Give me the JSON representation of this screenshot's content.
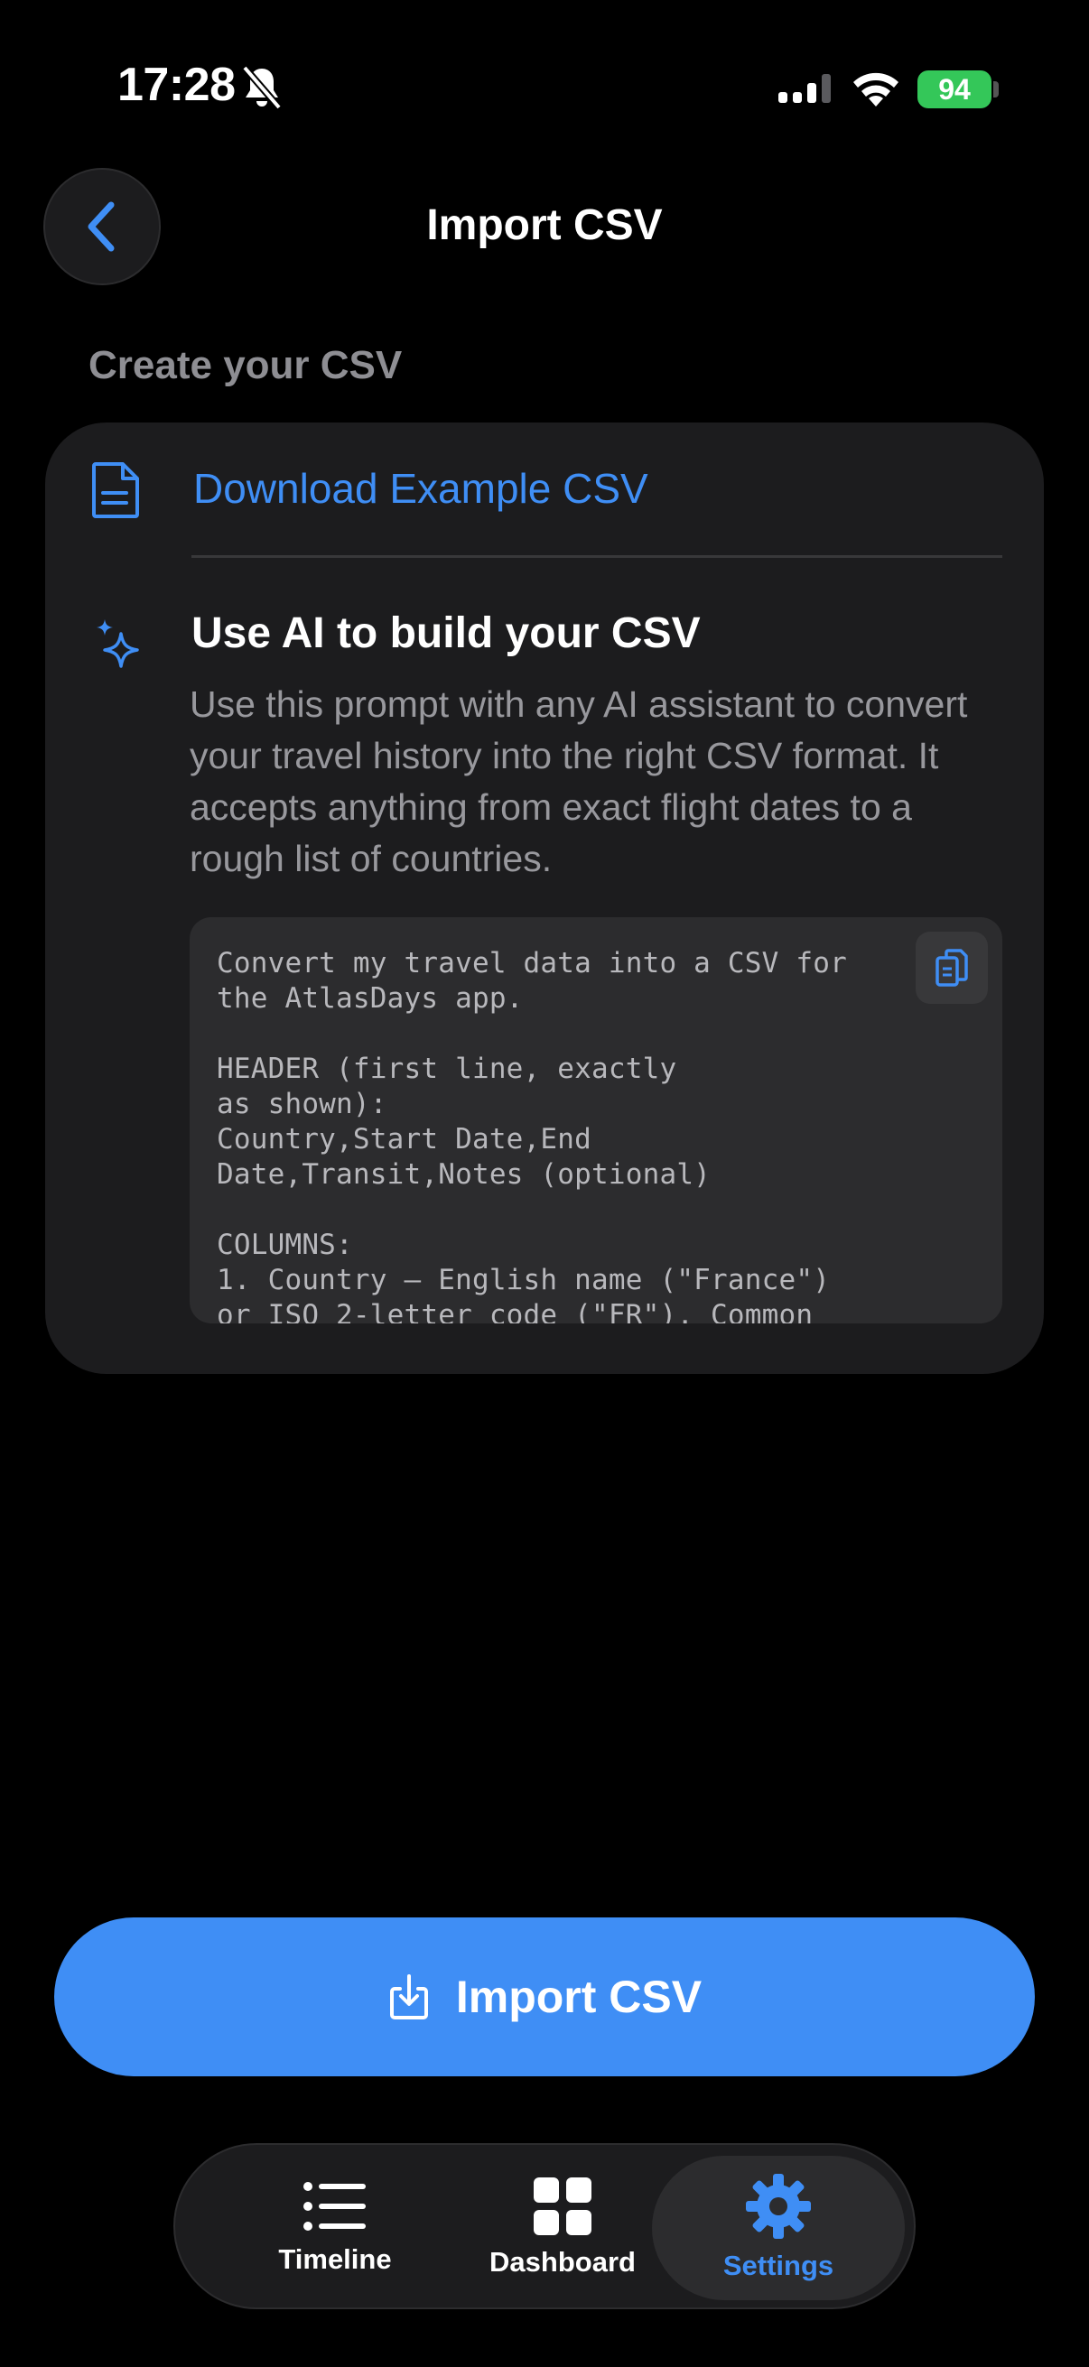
{
  "status_bar": {
    "time": "17:28",
    "battery": "94"
  },
  "header": {
    "title": "Import CSV",
    "back_icon": "chevron-left-icon"
  },
  "section": {
    "label": "Create your CSV"
  },
  "card": {
    "download_label": "Download Example CSV",
    "ai_title": "Use AI to build your CSV",
    "ai_description": "Use this prompt with any AI assistant to convert your travel history into the right CSV format. It accepts anything from exact flight dates to a rough list of countries.",
    "prompt_text": "Convert my travel data into a CSV for\nthe AtlasDays app.\n\nHEADER (first line, exactly\nas shown):\nCountry,Start Date,End\nDate,Transit,Notes (optional)\n\nCOLUMNS:\n1. Country — English name (\"France\")\nor ISO 2-letter code (\"FR\"). Common"
  },
  "import_button": {
    "label": "Import CSV"
  },
  "tab_bar": {
    "items": [
      {
        "label": "Timeline",
        "icon": "list-icon",
        "active": false
      },
      {
        "label": "Dashboard",
        "icon": "grid-icon",
        "active": false
      },
      {
        "label": "Settings",
        "icon": "gear-icon",
        "active": true
      }
    ]
  },
  "colors": {
    "accent": "#3f8ef5",
    "background": "#000000",
    "card": "#1c1c1e",
    "battery": "#34c759"
  }
}
